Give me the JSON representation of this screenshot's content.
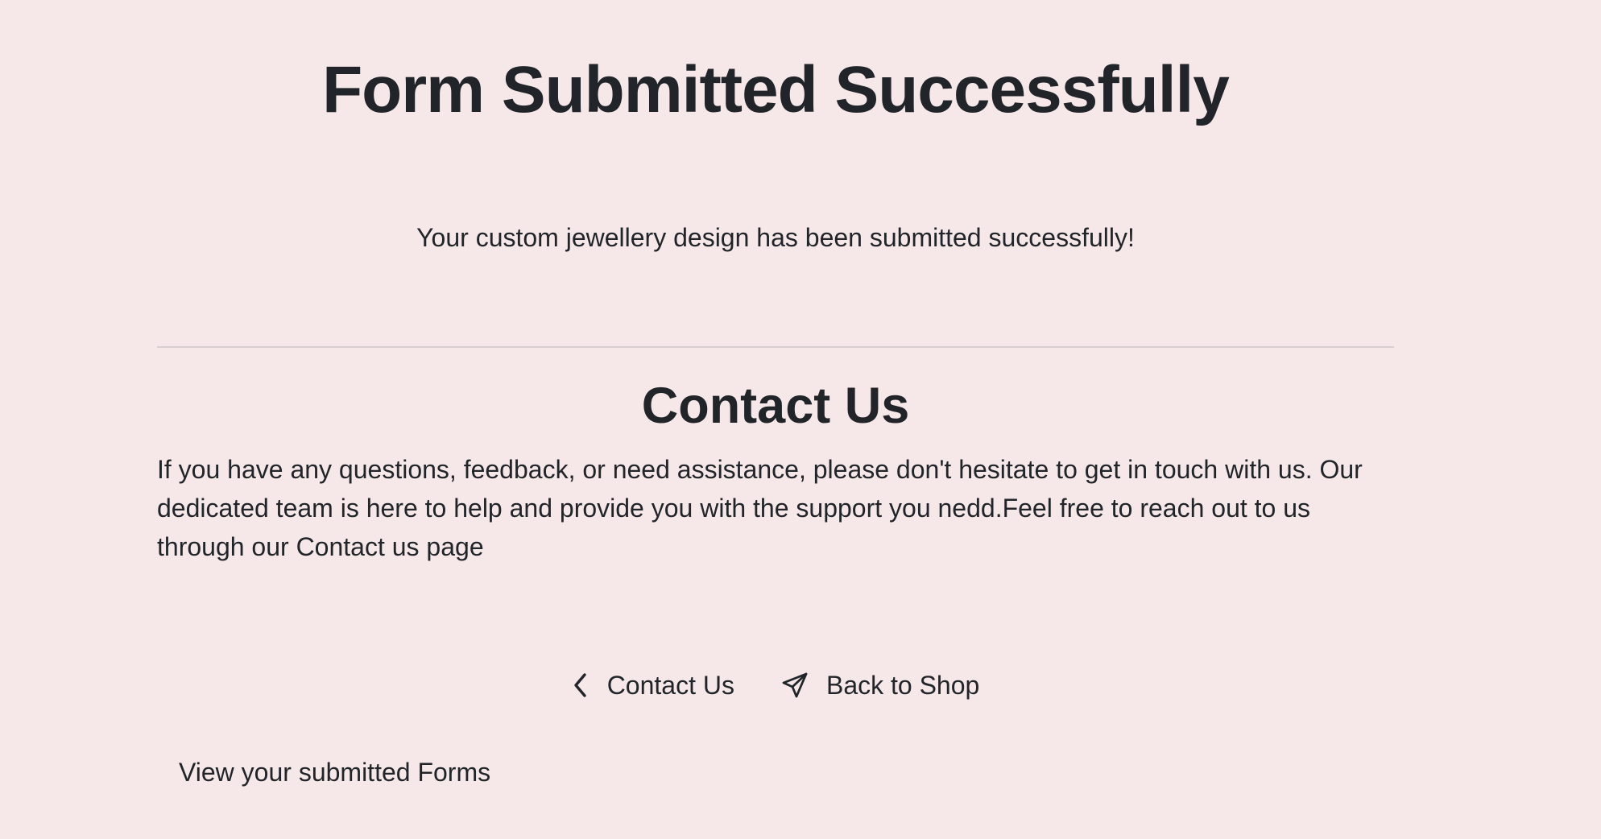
{
  "header": {
    "title": "Form Submitted Successfully",
    "message": "Your custom jewellery design has been submitted successfully!"
  },
  "contact": {
    "heading": "Contact Us",
    "body": "If you have any questions, feedback, or need assistance, please don't hesitate to get in touch with us. Our dedicated team is here to help and provide you with the support you nedd.Feel free to reach out to us through our Contact us page"
  },
  "actions": {
    "contact_label": "Contact Us",
    "contact_icon": "chevron-left-icon",
    "shop_label": "Back to Shop",
    "shop_icon": "send-icon"
  },
  "links": {
    "view_forms": "View your submitted Forms"
  },
  "colors": {
    "background": "#f6e8e9",
    "text": "#212529",
    "divider": "#d9cfd0"
  }
}
